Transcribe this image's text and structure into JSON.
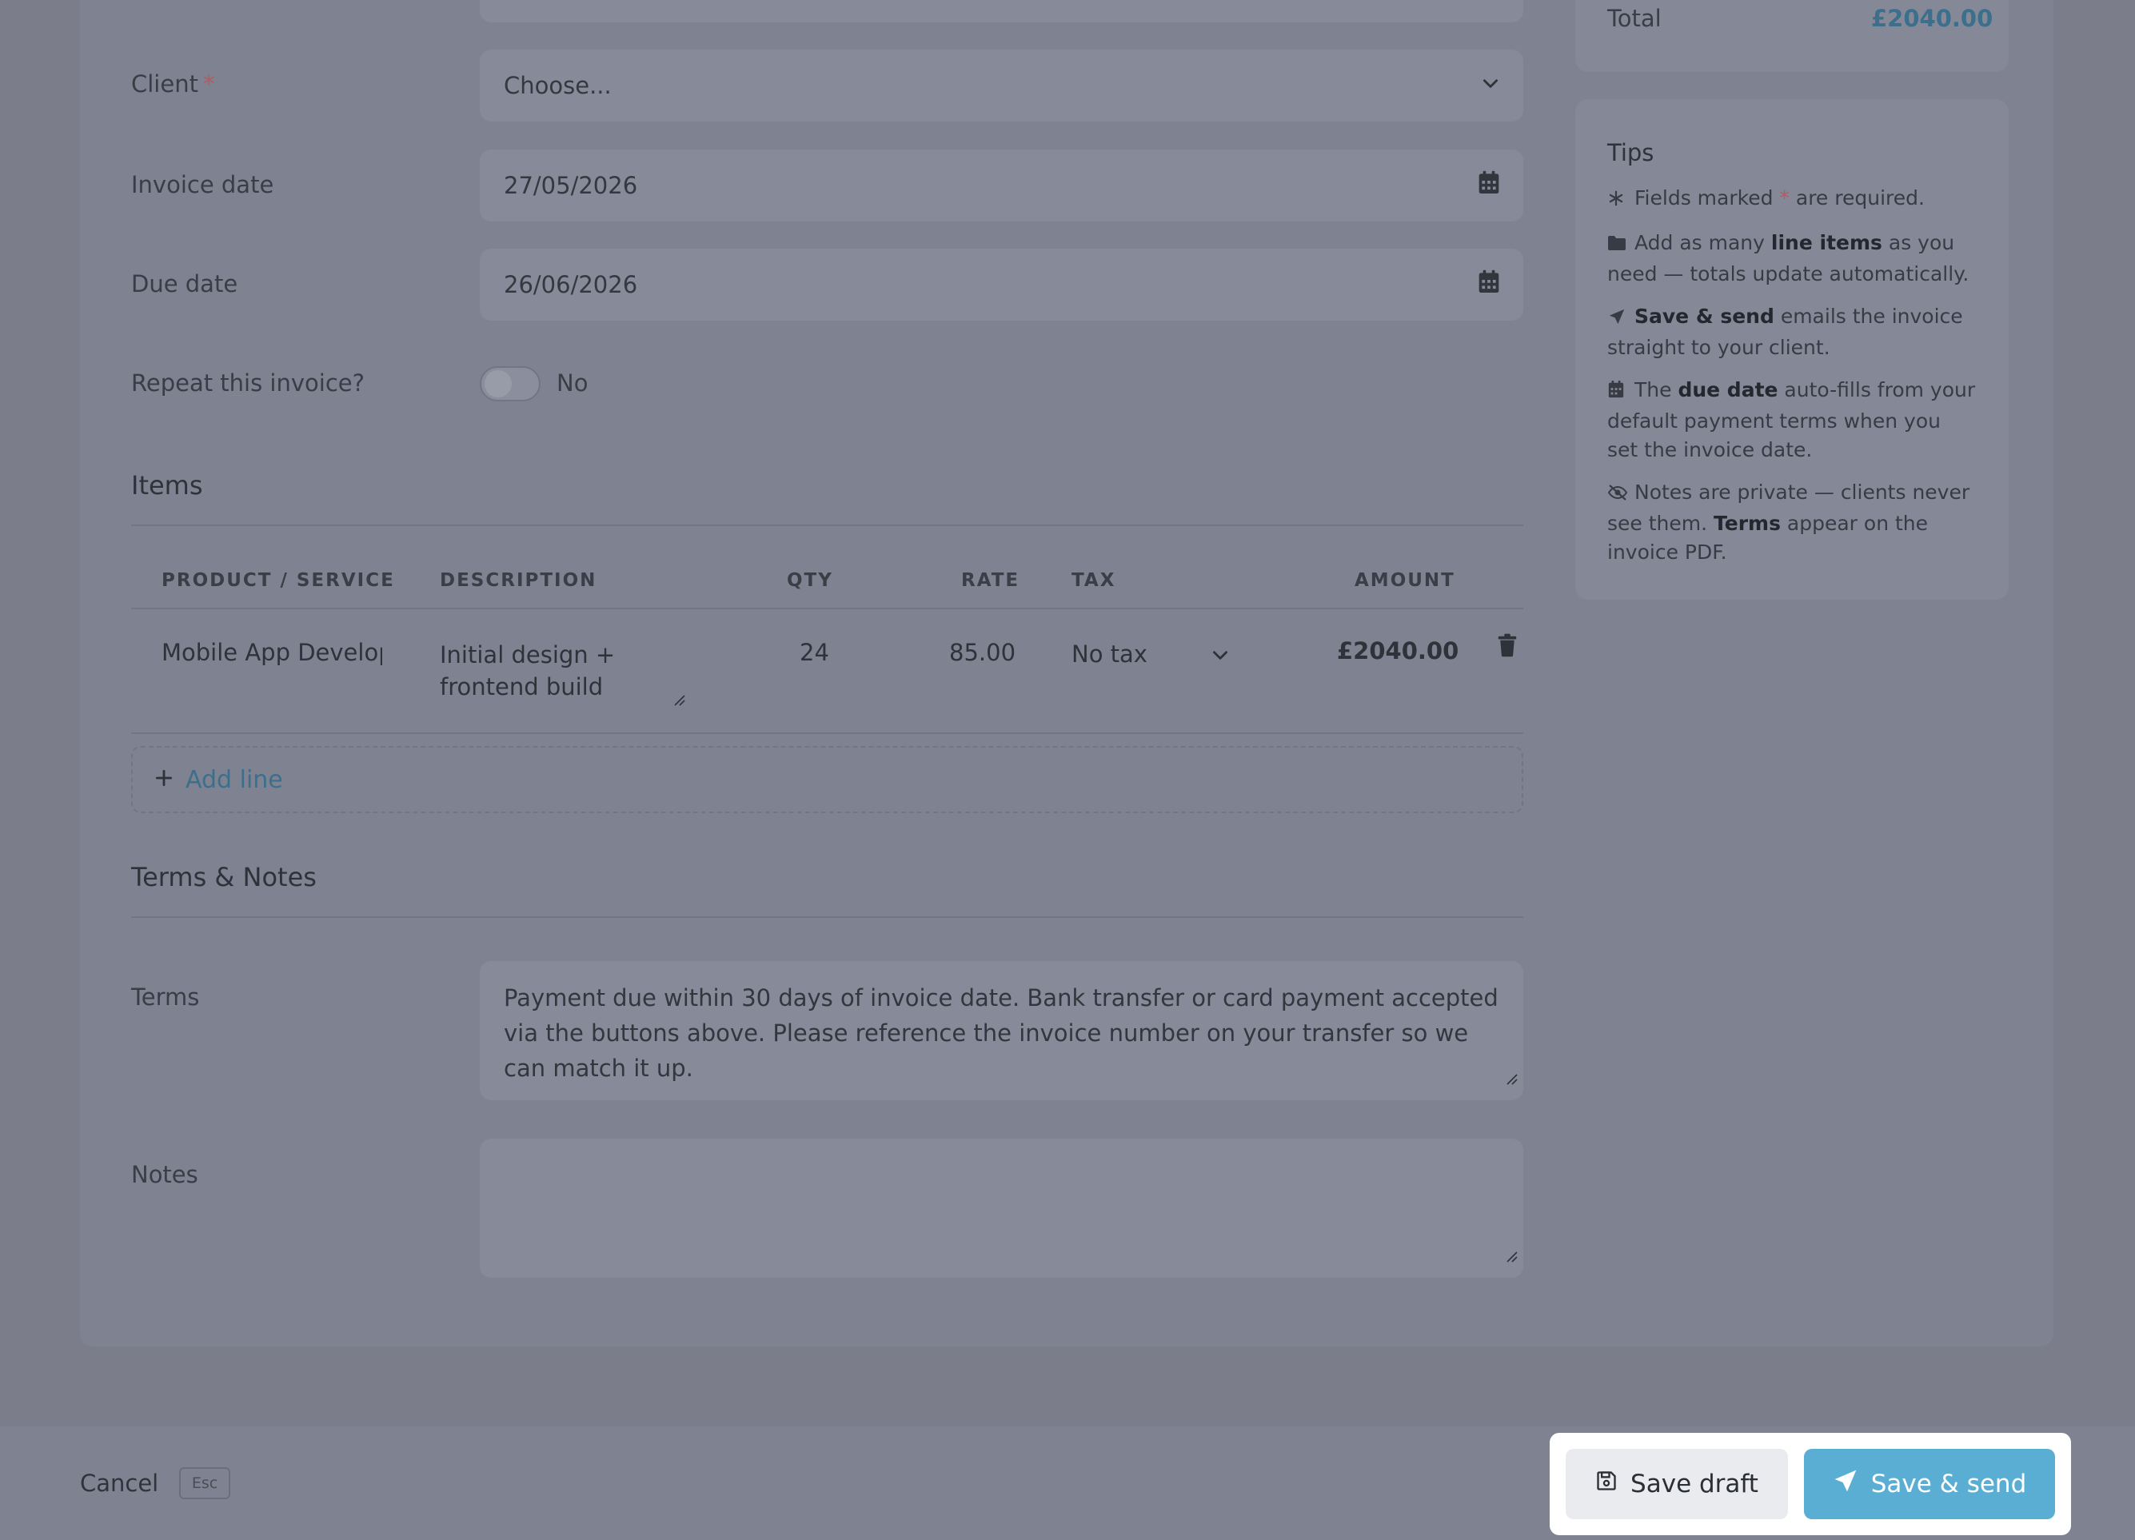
{
  "form": {
    "client": {
      "label": "Client",
      "required_mark": "*",
      "value": "Choose..."
    },
    "invoice_date": {
      "label": "Invoice date",
      "value": "27/05/2026"
    },
    "due_date": {
      "label": "Due date",
      "value": "26/06/2026"
    },
    "repeat": {
      "label": "Repeat this invoice?",
      "value": "No"
    }
  },
  "items": {
    "title": "Items",
    "columns": {
      "product": "PRODUCT / SERVICE",
      "description": "DESCRIPTION",
      "qty": "QTY",
      "rate": "RATE",
      "tax": "TAX",
      "amount": "AMOUNT"
    },
    "rows": [
      {
        "product": "Mobile App Develop",
        "description_line1": "Initial design +",
        "description_line2": "frontend build",
        "qty": "24",
        "rate": "85.00",
        "tax": "No tax",
        "amount": "£2040.00"
      }
    ],
    "add_line": "Add line"
  },
  "terms_notes": {
    "title": "Terms & Notes",
    "terms_label": "Terms",
    "terms_value": "Payment due within 30 days of invoice date. Bank transfer or card payment accepted via the buttons above. Please reference the invoice number on your transfer so we can match it up.",
    "notes_label": "Notes",
    "notes_value": ""
  },
  "summary": {
    "total_label": "Total",
    "total_value": "£2040.00"
  },
  "tips": {
    "title": "Tips",
    "t1_a": "Fields marked ",
    "t1_star": "*",
    "t1_b": " are required.",
    "t2_a": "Add as many ",
    "t2_bold": "line items",
    "t2_b": " as you need — totals update automatically.",
    "t3_bold": "Save & send",
    "t3_b": " emails the invoice straight to your client.",
    "t4_a": "The ",
    "t4_bold": "due date",
    "t4_b": " auto-fills from your default payment terms when you set the invoice date.",
    "t5_a": "Notes are private — clients never see them. ",
    "t5_bold": "Terms",
    "t5_b": " appear on the invoice PDF."
  },
  "footer": {
    "cancel": "Cancel",
    "esc": "Esc",
    "save_draft": "Save draft",
    "save_send": "Save & send"
  },
  "colors": {
    "accent": "#5baed3",
    "link": "#3b6f8c",
    "required": "#b35a5f"
  }
}
